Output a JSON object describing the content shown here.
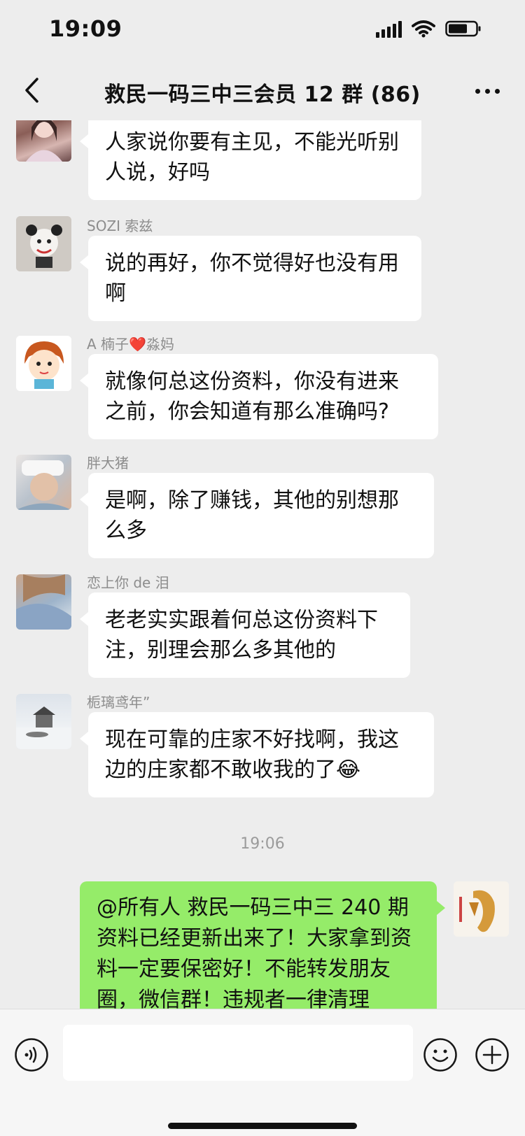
{
  "status_bar": {
    "time": "19:09",
    "battery_level": 0.7
  },
  "nav": {
    "title": "救民一码三中三会员 12 群 (86)"
  },
  "messages": [
    {
      "sender": "",
      "text": "人家说你要有主见，不能光听别\n人说，好吗"
    },
    {
      "sender": "SOZI 索兹",
      "text": "说的再好，你不觉得好也没有用\n啊"
    },
    {
      "sender": "A 楠子❤️淼妈",
      "text": "就像何总这份资料，你没有进来\n之前，你会知道有那么准确吗?"
    },
    {
      "sender": "胖大猪",
      "text": "是啊，除了赚钱，其他的别想那\n么多"
    },
    {
      "sender": "恋上你 de 泪",
      "text": "老老实实跟着何总这份资料下\n注，别理会那么多其他的"
    },
    {
      "sender": "栀璃鸢年”",
      "text": "现在可靠的庄家不好找啊，我这\n边的庄家都不敢收我的了😂"
    }
  ],
  "timestamp": "19:06",
  "self_message": {
    "text": "@所有人  救民一码三中三 240 期资料已经更新出来了！大家拿到资料一定要保密好！不能转发朋友圈，微信群！违规者一律清理"
  },
  "colors": {
    "background": "#ededed",
    "bubble_other": "#ffffff",
    "bubble_self": "#95ec69",
    "input_bar": "#f6f6f6"
  },
  "icons": {
    "back": "chevron-left-icon",
    "more": "more-dots-icon",
    "voice": "voice-icon",
    "emoji": "emoji-icon",
    "add": "plus-icon"
  },
  "input": {
    "value": "",
    "placeholder": ""
  }
}
